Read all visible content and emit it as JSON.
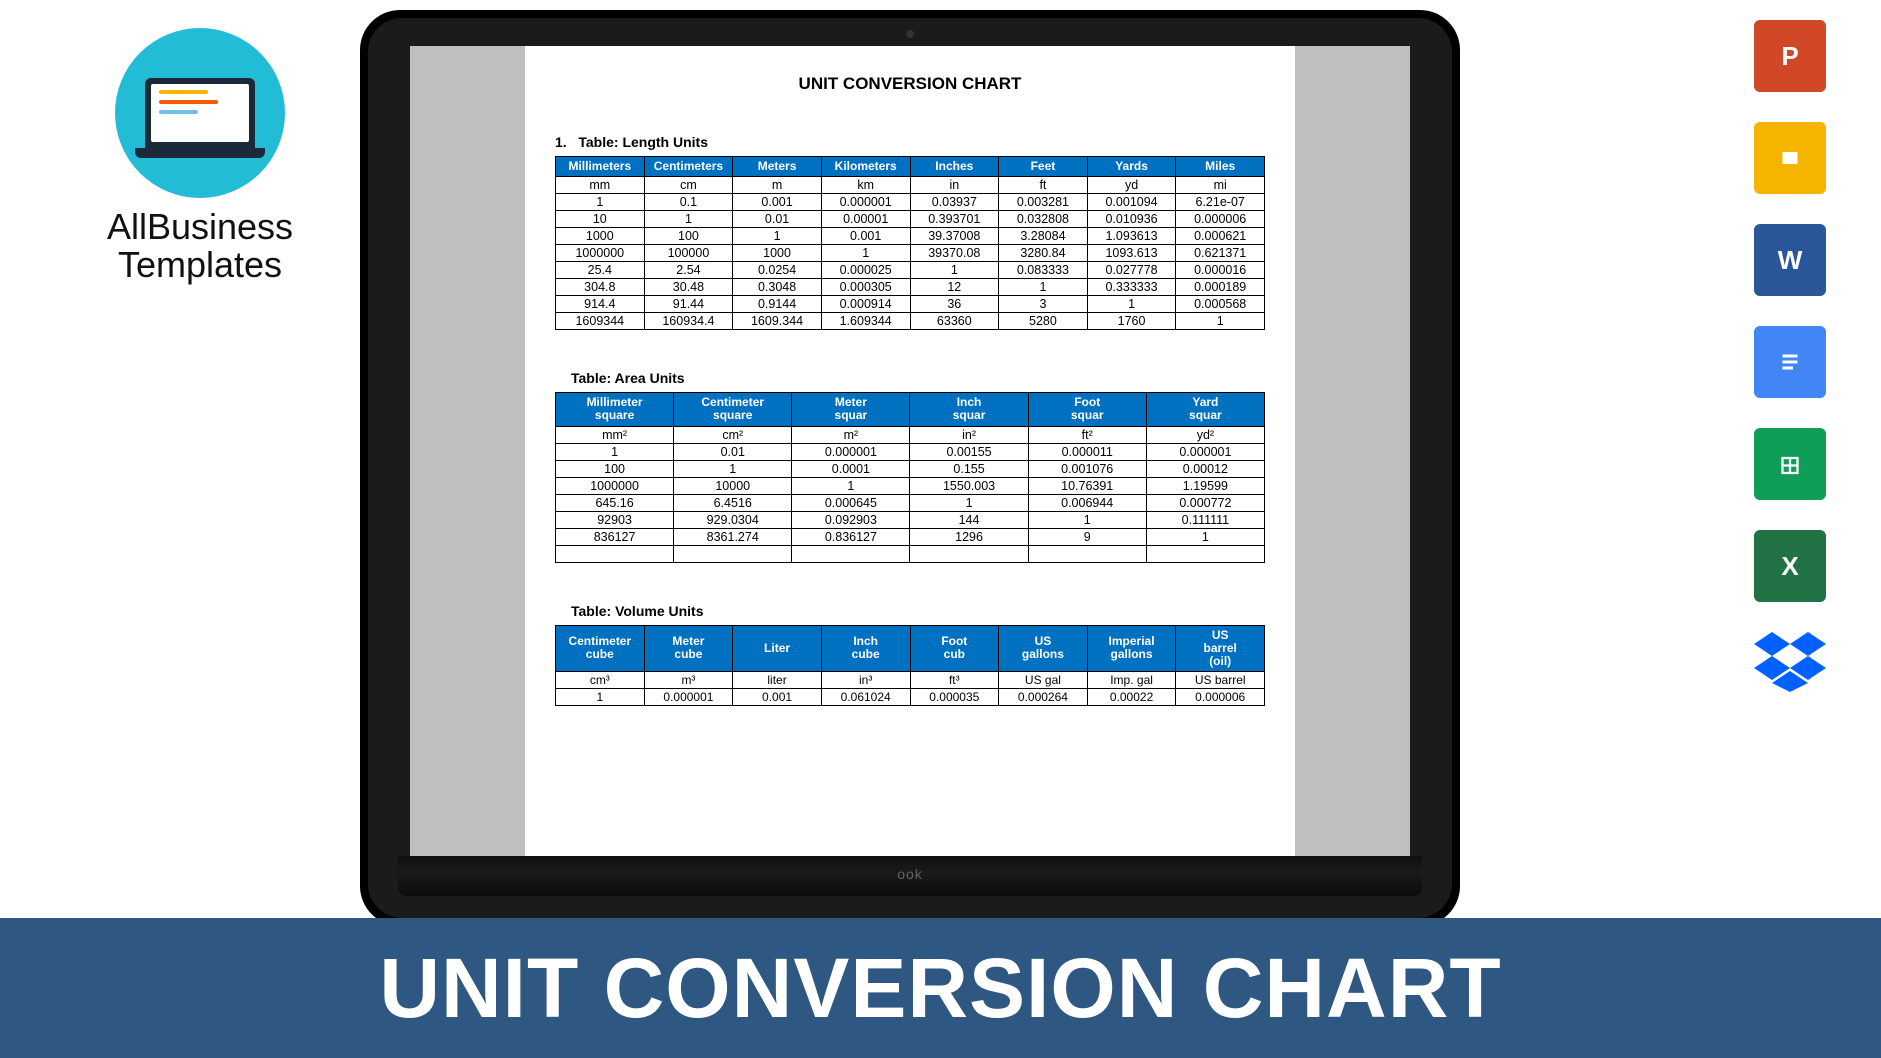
{
  "brand": {
    "line1": "AllBusiness",
    "line2": "Templates"
  },
  "banner": {
    "title": "UNIT CONVERSION CHART"
  },
  "doc": {
    "title": "UNIT CONVERSION CHART",
    "section1_label": "Table:  Length Units",
    "section2_label": "Table:  Area Units",
    "section3_label": "Table:  Volume Units"
  },
  "chart_data": [
    {
      "type": "table",
      "title": "Length Units",
      "headers": [
        "Millimeters",
        "Centimeters",
        "Meters",
        "Kilometers",
        "Inches",
        "Feet",
        "Yards",
        "Miles"
      ],
      "unit_row": [
        "mm",
        "cm",
        "m",
        "km",
        "in",
        "ft",
        "yd",
        "mi"
      ],
      "rows": [
        [
          "1",
          "0.1",
          "0.001",
          "0.000001",
          "0.03937",
          "0.003281",
          "0.001094",
          "6.21e-07"
        ],
        [
          "10",
          "1",
          "0.01",
          "0.00001",
          "0.393701",
          "0.032808",
          "0.010936",
          "0.000006"
        ],
        [
          "1000",
          "100",
          "1",
          "0.001",
          "39.37008",
          "3.28084",
          "1.093613",
          "0.000621"
        ],
        [
          "1000000",
          "100000",
          "1000",
          "1",
          "39370.08",
          "3280.84",
          "1093.613",
          "0.621371"
        ],
        [
          "25.4",
          "2.54",
          "0.0254",
          "0.000025",
          "1",
          "0.083333",
          "0.027778",
          "0.000016"
        ],
        [
          "304.8",
          "30.48",
          "0.3048",
          "0.000305",
          "12",
          "1",
          "0.333333",
          "0.000189"
        ],
        [
          "914.4",
          "91.44",
          "0.9144",
          "0.000914",
          "36",
          "3",
          "1",
          "0.000568"
        ],
        [
          "1609344",
          "160934.4",
          "1609.344",
          "1.609344",
          "63360",
          "5280",
          "1760",
          "1"
        ]
      ]
    },
    {
      "type": "table",
      "title": "Area Units",
      "headers": [
        "Millimeter square",
        "Centimeter square",
        "Meter squar",
        "Inch squar",
        "Foot squar",
        "Yard squar"
      ],
      "unit_row": [
        "mm²",
        "cm²",
        "m²",
        "in²",
        "ft²",
        "yd²"
      ],
      "rows": [
        [
          "1",
          "0.01",
          "0.000001",
          "0.00155",
          "0.000011",
          "0.000001"
        ],
        [
          "100",
          "1",
          "0.0001",
          "0.155",
          "0.001076",
          "0.00012"
        ],
        [
          "1000000",
          "10000",
          "1",
          "1550.003",
          "10.76391",
          "1.19599"
        ],
        [
          "645.16",
          "6.4516",
          "0.000645",
          "1",
          "0.006944",
          "0.000772"
        ],
        [
          "92903",
          "929.0304",
          "0.092903",
          "144",
          "1",
          "0.111111"
        ],
        [
          "836127",
          "8361.274",
          "0.836127",
          "1296",
          "9",
          "1"
        ]
      ]
    },
    {
      "type": "table",
      "title": "Volume Units",
      "headers": [
        "Centimeter cube",
        "Meter cube",
        "Liter",
        "Inch cube",
        "Foot cub",
        "US gallons",
        "Imperial gallons",
        "US barrel (oil)"
      ],
      "unit_row": [
        "cm³",
        "m³",
        "liter",
        "in³",
        "ft³",
        "US gal",
        "Imp. gal",
        "US barrel"
      ],
      "rows": [
        [
          "1",
          "0.000001",
          "0.001",
          "0.061024",
          "0.000035",
          "0.000264",
          "0.00022",
          "0.000006"
        ]
      ]
    }
  ],
  "apps": {
    "ppt": "P",
    "slides": "",
    "word": "W",
    "docs": "",
    "sheets": "",
    "excel": "X"
  }
}
